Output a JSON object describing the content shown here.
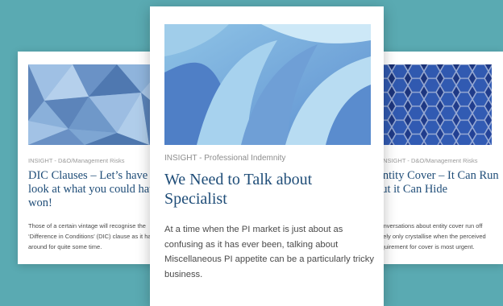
{
  "cards": [
    {
      "tag": "INSIGHT - D&O/Management Risks",
      "title": "DIC Clauses – Let’s have a look at what you could have won!",
      "excerpt": "Those of a certain vintage will recognise the ‘Difference in Conditions’ (DIC) clause as it has been around for quite some time.",
      "image": "geometric-blue-abstract"
    },
    {
      "tag": "INSIGHT - Professional Indemnity",
      "title": "We Need to Talk about Specialist",
      "excerpt": "At a time when the PI market is just about as confusing as it has ever been, talking about Miscellaneous PI appetite can be a particularly tricky business.",
      "image": "curved-panels-blue-abstract"
    },
    {
      "tag": "INSIGHT - D&O/Management Risks",
      "title": "Entity Cover – It Can Run but it Can Hide",
      "excerpt": "Conversations about entity cover run off rarely only crystallise when the perceived requirement for cover is most urgent.",
      "image": "hexagon-mesh-blue"
    }
  ],
  "colors": {
    "background": "#5aaab2",
    "title": "#1f4d78",
    "tag": "#9a9a9a",
    "text": "#4a4a4a"
  }
}
